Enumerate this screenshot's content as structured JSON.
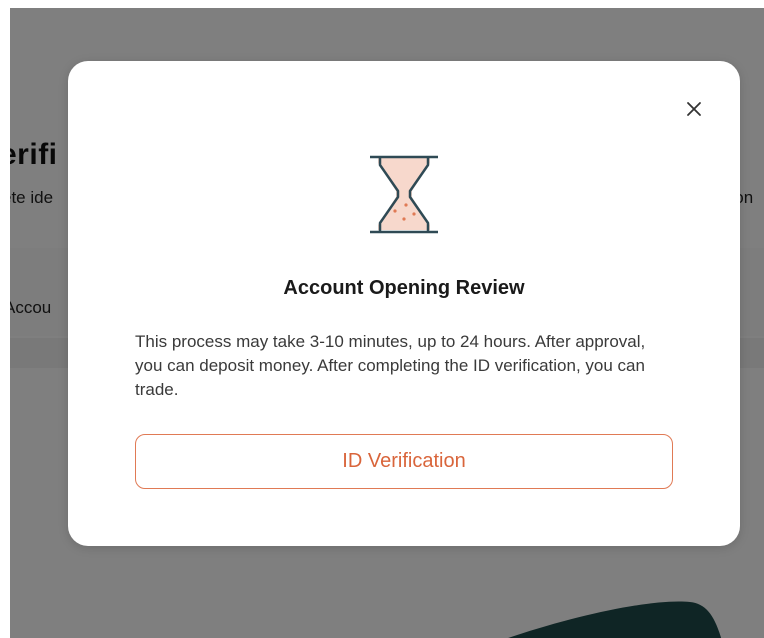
{
  "background": {
    "title_fragment": "erifi",
    "subtitle_left_fragment": "ete ide",
    "subtitle_right_fragment": "sion",
    "account_fragment": "Accou"
  },
  "modal": {
    "icon": "hourglass-icon",
    "close_icon": "close-icon",
    "title": "Account Opening Review",
    "body": "This process may take 3-10 minutes, up to 24 hours. After approval, you can deposit money. After completing the ID verification, you can trade.",
    "button_label": "ID Verification"
  },
  "colors": {
    "accent": "#d9653b",
    "accent_border": "#e07a55",
    "hourglass_sand": "#f7d8cc",
    "hourglass_frame": "#2f4a55",
    "overlay": "rgba(0,0,0,0.5)"
  }
}
